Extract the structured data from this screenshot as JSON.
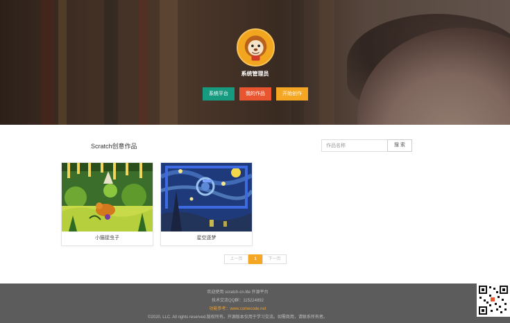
{
  "hero": {
    "username": "系统管理员",
    "buttons": {
      "platform": "系统平台",
      "my_works": "我的作品",
      "start_create": "开始创作"
    },
    "colors": {
      "green": "#169a80",
      "red": "#e9552f",
      "yellow": "#f5a623"
    }
  },
  "main": {
    "section_title": "Scratch创意作品",
    "search": {
      "placeholder": "作品名称",
      "button": "搜 索"
    },
    "works": [
      {
        "title": "小猫捉虫子",
        "thumb_icon": "jungle-scene"
      },
      {
        "title": "星空逐梦",
        "thumb_icon": "starry-night-scene"
      }
    ],
    "pagination": {
      "prev": "上一页",
      "current": "1",
      "next": "下一页"
    }
  },
  "footer": {
    "line1": "欢迎使用 scratch-cn.lite 开源平台",
    "line2": "技术交流QQ群：115224892",
    "line3_label": "功能参考：",
    "line3_url": "www.comecode.net",
    "line4": "©2020, LLC. All rights reserved.版权所有。开源版本仅用于学习交流。如需商用，请联系所有者。"
  }
}
